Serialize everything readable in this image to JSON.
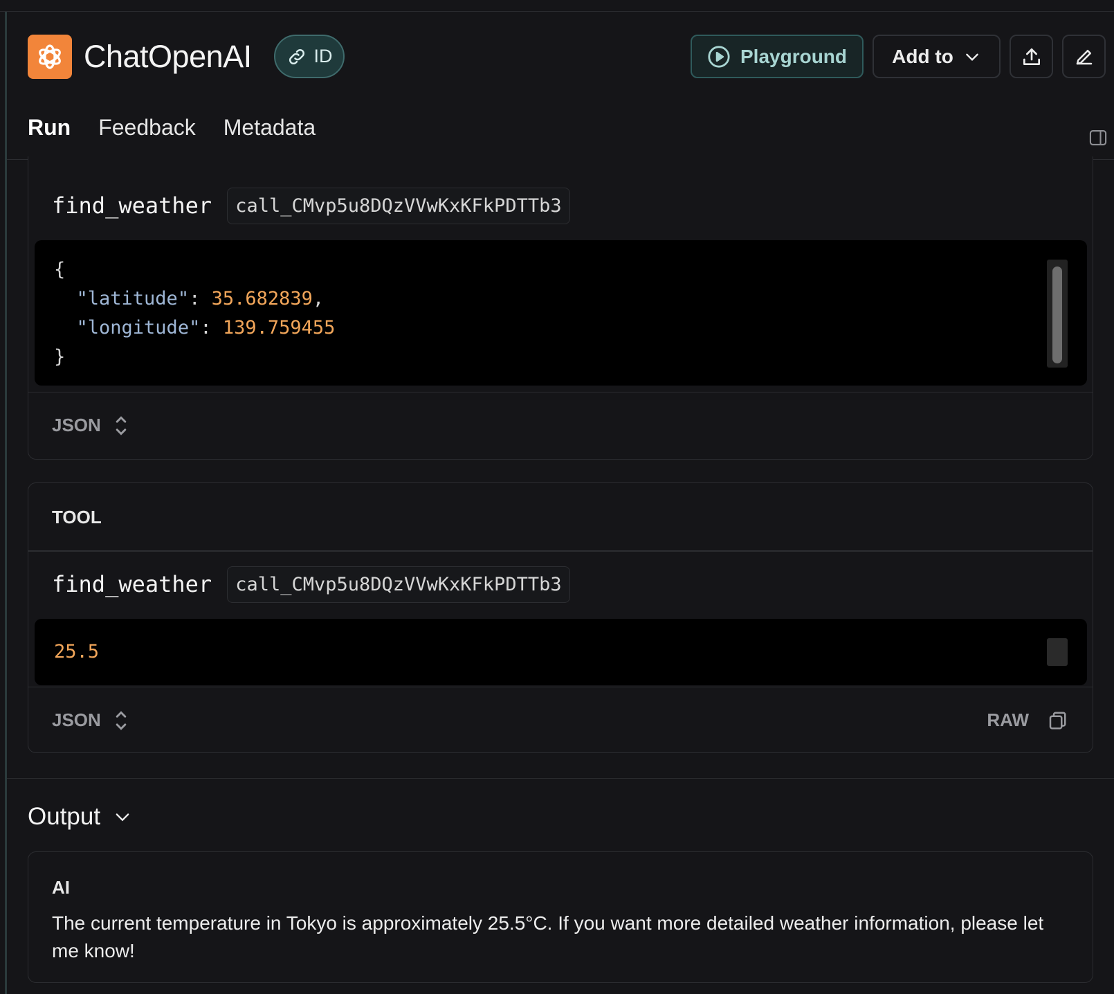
{
  "header": {
    "title": "ChatOpenAI",
    "id_chip_label": "ID",
    "playground_label": "Playground",
    "add_to_label": "Add to"
  },
  "tabs": [
    {
      "label": "Run",
      "active": true
    },
    {
      "label": "Feedback",
      "active": false
    },
    {
      "label": "Metadata",
      "active": false
    }
  ],
  "tool_call": {
    "name": "find_weather",
    "call_id": "call_CMvp5u8DQzVVwKxKFkPDTTb3",
    "args_lines": {
      "open": "{",
      "lat_key": "\"latitude\"",
      "lat_val": "35.682839",
      "lon_key": "\"longitude\"",
      "lon_val": "139.759455",
      "close": "}"
    },
    "format_label": "JSON"
  },
  "tool_message": {
    "role_label": "TOOL",
    "name": "find_weather",
    "call_id": "call_CMvp5u8DQzVVwKxKFkPDTTb3",
    "content": "25.5",
    "format_label": "JSON",
    "raw_label": "RAW"
  },
  "output": {
    "section_label": "Output",
    "role_label": "AI",
    "text": "The current temperature in Tokyo is approximately 25.5°C. If you want more detailed weather information, please let me know!"
  },
  "colors": {
    "background": "#151518",
    "accent_orange": "#f2853a",
    "teal_chip": "#1f3a3b",
    "json_key": "#9fb7d6",
    "json_number": "#f2a65a"
  }
}
